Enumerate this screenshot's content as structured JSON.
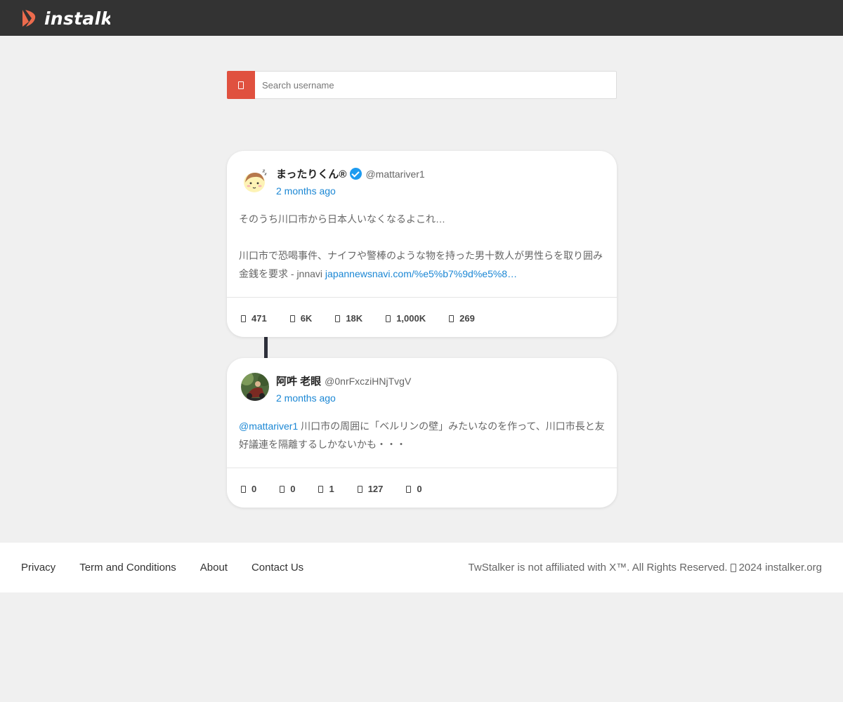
{
  "header": {
    "logo_text": "instalk",
    "brand_color": "#ec6b4d"
  },
  "search": {
    "placeholder": "Search username",
    "button_icon": "search-icon",
    "accent_color": "#e0513f"
  },
  "posts": [
    {
      "author_name": "まったりくん®",
      "verified": true,
      "handle": "@mattariver1",
      "time": "2 months ago",
      "text_line1": "そのうち川口市から日本人いなくなるよこれ…",
      "text_line2": "川口市で恐喝事件、ナイフや警棒のような物を持った男十数人が男性らを取り囲み金銭を要求 - jnnavi",
      "link": "japannewsnavi.com/%e5%b7%9d%e5%8…",
      "stats": {
        "replies": "471",
        "retweets": "6K",
        "likes": "18K",
        "views": "1,000K",
        "bookmarks": "269"
      }
    },
    {
      "author_name": "阿吽 老眼",
      "verified": false,
      "handle": "@0nrFxcziHNjTvgV",
      "time": "2 months ago",
      "mention": "@mattariver1",
      "text": " 川口市の周囲に「ベルリンの壁」みたいなのを作って、川口市長と友好議連を隔離するしかないかも・・・",
      "stats": {
        "replies": "0",
        "retweets": "0",
        "likes": "1",
        "views": "127",
        "bookmarks": "0"
      }
    }
  ],
  "footer": {
    "links": [
      "Privacy",
      "Term and Conditions",
      "About",
      "Contact Us"
    ],
    "note_before": "TwStalker is not affiliated with X™. All Rights Reserved.",
    "note_after": "2024 instalker.org"
  }
}
